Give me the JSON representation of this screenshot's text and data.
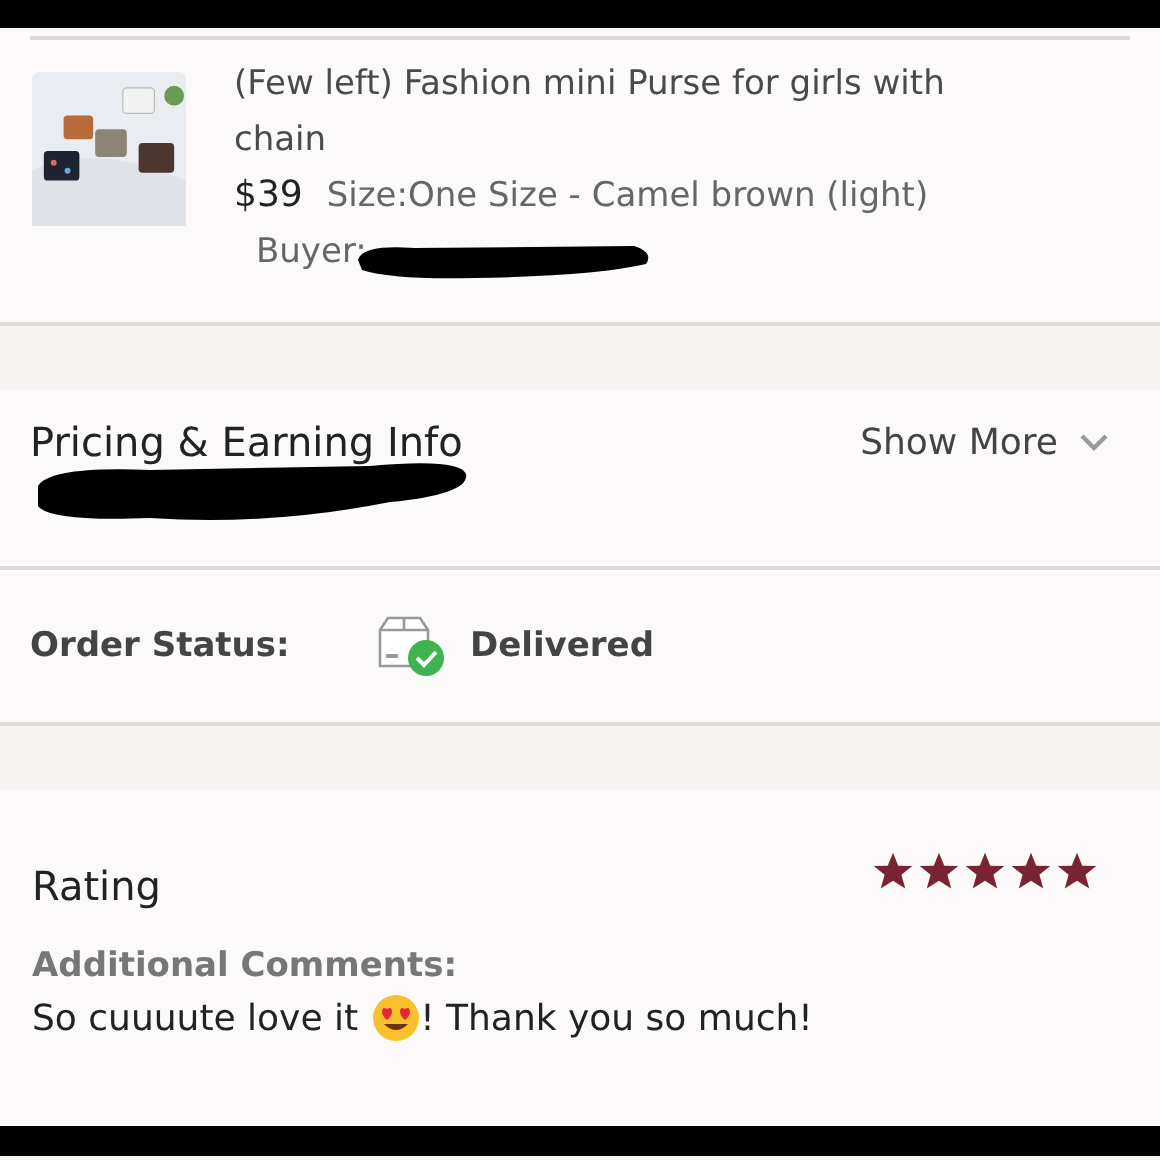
{
  "product": {
    "title": "(Few left) Fashion mini Purse for girls with chain",
    "price": "$39",
    "variant": "Size:One Size - Camel brown (light)",
    "buyer_label": "Buyer:"
  },
  "pricing": {
    "title": "Pricing & Earning Info",
    "toggle": "Show More"
  },
  "order_status": {
    "label": "Order Status:",
    "value": "Delivered"
  },
  "rating": {
    "title": "Rating",
    "stars": 5,
    "comments_label": "Additional Comments:",
    "comment_before": "So cuuuute love it",
    "comment_after": "! Thank you so much!"
  }
}
